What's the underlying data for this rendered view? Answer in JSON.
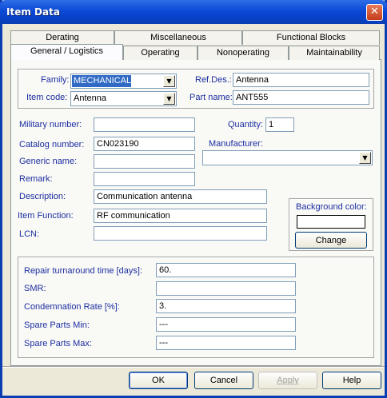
{
  "window": {
    "title": "Item Data",
    "close_glyph": "✕"
  },
  "tabs_back": [
    "Derating",
    "Miscellaneous",
    "Functional Blocks"
  ],
  "tabs_front": [
    "General / Logistics",
    "Operating",
    "Nonoperating",
    "Maintainability"
  ],
  "top_group": {
    "family_label": "Family:",
    "family_value": "MECHANICAL",
    "item_code_label": "Item code:",
    "item_code_value": "Antenna",
    "refdes_label": "Ref.Des.:",
    "refdes_value": "Antenna",
    "part_name_label": "Part name:",
    "part_name_value": "ANT555"
  },
  "fields": {
    "military_number_label": "Military number:",
    "military_number_value": "",
    "quantity_label": "Quantity:",
    "quantity_value": "1",
    "catalog_number_label": "Catalog number:",
    "catalog_number_value": "CN023190",
    "manufacturer_label": "Manufacturer:",
    "manufacturer_value": "",
    "generic_name_label": "Generic name:",
    "generic_name_value": "",
    "remark_label": "Remark:",
    "remark_value": "",
    "description_label": "Description:",
    "description_value": "Communication antenna",
    "item_function_label": "Item Function:",
    "item_function_value": "RF communication",
    "lcn_label": "LCN:",
    "lcn_value": ""
  },
  "background": {
    "label": "Background color:",
    "change_label": "Change",
    "color": "#ffffff"
  },
  "repair_group": {
    "repair_tat_label": "Repair turnaround time [days]:",
    "repair_tat_value": "60.",
    "smr_label": "SMR:",
    "smr_value": "",
    "condemnation_label": "Condemnation Rate [%]:",
    "condemnation_value": "3.",
    "spare_min_label": "Spare Parts Min:",
    "spare_min_value": "---",
    "spare_max_label": "Spare Parts Max:",
    "spare_max_value": "---"
  },
  "buttons": {
    "ok": "OK",
    "cancel": "Cancel",
    "apply": "Apply",
    "help": "Help"
  },
  "colors": {
    "title_bar": "#0b4ad6",
    "label_text": "#1c2ea0",
    "selection": "#316ac5",
    "dialog_bg": "#ece9d8"
  }
}
